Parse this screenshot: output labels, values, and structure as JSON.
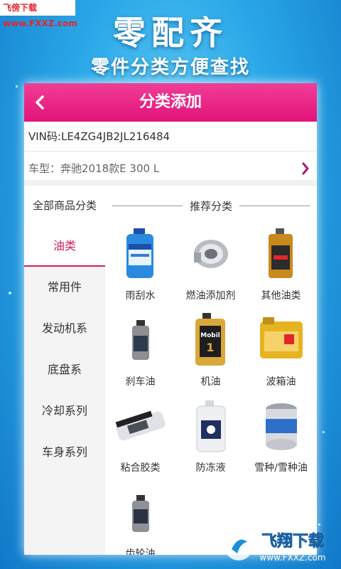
{
  "watermark_top": "飞傍下载 www.FXXZ.com",
  "banner": {
    "title": "零配齐",
    "subtitle": "零件分类方便查找"
  },
  "header": {
    "title": "分类添加",
    "back_icon": "chevron-left-icon"
  },
  "vin": "VIN码:LE4ZG4JB2JL216484",
  "car_model": "车型：奔驰2018款E 300 L",
  "sidebar": {
    "title": "全部商品分类",
    "items": [
      {
        "label": "油类",
        "active": true
      },
      {
        "label": "常用件",
        "active": false
      },
      {
        "label": "发动机系",
        "active": false
      },
      {
        "label": "底盘系",
        "active": false
      },
      {
        "label": "冷却系列",
        "active": false
      },
      {
        "label": "车身系列",
        "active": false
      }
    ]
  },
  "recommend": {
    "title": "推荐分类",
    "items": [
      {
        "label": "雨刮水",
        "icon": "washer-fluid-bottle-icon"
      },
      {
        "label": "燃油添加剂",
        "icon": "fuel-filter-icon"
      },
      {
        "label": "其他油类",
        "icon": "oil-can-icon"
      },
      {
        "label": "刹车油",
        "icon": "brake-fluid-bottle-icon"
      },
      {
        "label": "机油",
        "icon": "engine-oil-bottle-icon"
      },
      {
        "label": "波箱油",
        "icon": "gearbox-oil-drum-icon"
      },
      {
        "label": "粘合胶类",
        "icon": "adhesive-tube-icon"
      },
      {
        "label": "防冻液",
        "icon": "antifreeze-jug-icon"
      },
      {
        "label": "雪种/雪种油",
        "icon": "refrigerant-can-icon"
      },
      {
        "label": "齿轮油",
        "icon": "gear-oil-bottle-icon"
      }
    ]
  },
  "watermark_bottom": {
    "text": "飞翔下载",
    "url": "www.FXXZ.com"
  },
  "colors": {
    "accent": "#e3127a",
    "active": "#d81b60"
  }
}
